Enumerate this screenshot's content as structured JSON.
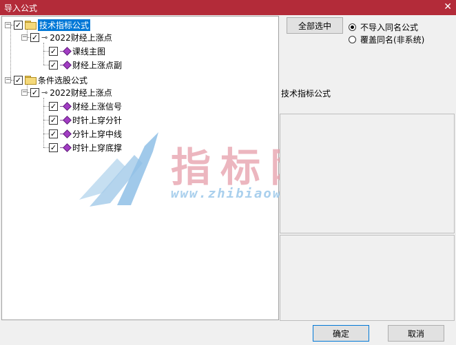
{
  "window": {
    "title": "导入公式",
    "close_glyph": "✕"
  },
  "tree": {
    "roots": [
      {
        "label": "技术指标公式",
        "expander": "−",
        "checked": true,
        "selected": true,
        "children": [
          {
            "label": "2022财经上涨点",
            "expander": "−",
            "checked": true,
            "children": [
              {
                "label": "课线主图",
                "checked": true
              },
              {
                "label": "财经上涨点副",
                "checked": true
              }
            ]
          }
        ]
      },
      {
        "label": "条件选股公式",
        "expander": "−",
        "checked": true,
        "children": [
          {
            "label": "2022财经上涨点",
            "expander": "−",
            "checked": true,
            "children": [
              {
                "label": "财经上涨信号",
                "checked": true
              },
              {
                "label": "时针上穿分针",
                "checked": true
              },
              {
                "label": "分针上穿中线",
                "checked": true
              },
              {
                "label": "时针上穿底撑",
                "checked": true
              }
            ]
          }
        ]
      }
    ]
  },
  "right_panel": {
    "select_all_label": "全部选中",
    "radio_options": [
      {
        "label": "不导入同名公式",
        "selected": true
      },
      {
        "label": "覆盖同名(非系统)",
        "selected": false
      }
    ],
    "section_label": "技术指标公式"
  },
  "watermark": {
    "big_text": "指标网",
    "url_text": "www.zhibiaow.com"
  },
  "footer": {
    "ok_label": "确定",
    "cancel_label": "取消"
  }
}
